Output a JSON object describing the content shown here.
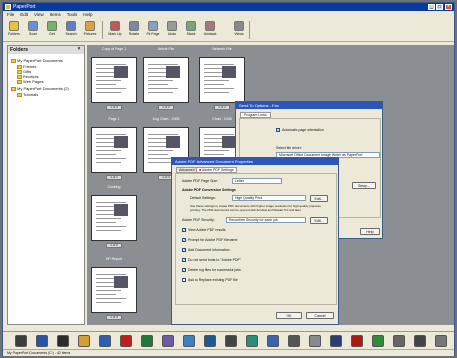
{
  "app": {
    "title": "PaperPort"
  },
  "menu": [
    "File",
    "Edit",
    "View",
    "Items",
    "Tools",
    "Help"
  ],
  "toolbar": [
    {
      "label": "Folders",
      "icon": "folder-icon"
    },
    {
      "label": "Scan",
      "icon": "scan-icon"
    },
    {
      "label": "Get",
      "icon": "get-photo-icon"
    },
    {
      "label": "Search",
      "icon": "search-icon"
    },
    {
      "label": "Pictures",
      "icon": "pictures-icon"
    },
    {
      "label": "Mark Up",
      "icon": "markup-icon"
    },
    {
      "label": "Rotate",
      "icon": "rotate-icon"
    },
    {
      "label": "Fit Page",
      "icon": "fit-page-icon"
    },
    {
      "label": "Undo",
      "icon": "undo-icon"
    },
    {
      "label": "Stack",
      "icon": "stack-icon"
    },
    {
      "label": "Unstack",
      "icon": "unstack-icon"
    },
    {
      "label": "Views",
      "icon": "views-icon"
    }
  ],
  "folders": {
    "title": "Folders",
    "items": [
      {
        "label": "My PaperPort Documents",
        "level": 0
      },
      {
        "label": "Friends",
        "level": 1
      },
      {
        "label": "Gifts",
        "level": 1
      },
      {
        "label": "Receipts",
        "level": 1
      },
      {
        "label": "Web Pages",
        "level": 1
      },
      {
        "label": "My PaperPort Documents (2)",
        "level": 0
      },
      {
        "label": "Tutorials",
        "level": 1
      }
    ]
  },
  "thumbs": [
    {
      "label": "Copy of Page 1",
      "badge": "1 of 3"
    },
    {
      "label": "Article File",
      "badge": "1 of 2"
    },
    {
      "label": "Network File",
      "badge": "1 of 1"
    },
    {
      "label": "Page 1",
      "badge": "1 of 1"
    },
    {
      "label": "Dog Chart - 2005",
      "badge": "1 of 1"
    },
    {
      "label": "Chart - 2006",
      "badge": "1 of 1"
    },
    {
      "label": "Cooking",
      "badge": "1 of 2"
    },
    {
      "label": "HP Report",
      "badge": "1 of 3"
    }
  ],
  "dialog_back": {
    "title": "Send To Options - Fax",
    "tab": "Program Links",
    "check": "Automatic page orientation",
    "select_label": "Select file driver:",
    "select_value": "Microsoft Office Document Image Writer as PaperPort",
    "button": "Setup...",
    "help": "Help"
  },
  "dialog_front": {
    "title": "Adobe PDF Advanced Document Properties",
    "tabs": [
      "Advanced",
      "Adobe PDF Settings"
    ],
    "page_size_label": "Adobe PDF Page Size:",
    "page_size_value": "Letter",
    "conversion_label": "Adobe PDF Conversion Settings",
    "default_label": "Default Settings:",
    "default_value": "High Quality Print",
    "edit_label": "Edit...",
    "desc": "Use these settings to create PDF documents with higher image resolution for high-quality prepress printing. The PDF documents can be opened with Acrobat and Reader 5.0 and later.",
    "security_label": "Adobe PDF Security:",
    "security_value": "Reconfirm Security for each job",
    "checks": [
      {
        "label": "View Adobe PDF results",
        "checked": true
      },
      {
        "label": "Prompt for Adobe PDF filename",
        "checked": true
      },
      {
        "label": "Add Document Information",
        "checked": true
      },
      {
        "label": "Do not send fonts to \"Adobe PDF\"",
        "checked": true
      },
      {
        "label": "Delete log files for successful jobs",
        "checked": true
      },
      {
        "label": "Ask to Replace existing PDF file",
        "checked": false
      }
    ],
    "ok": "OK",
    "cancel": "Cancel"
  },
  "apps": [
    {
      "name": "printer-icon",
      "color": "#3d3d3d"
    },
    {
      "name": "pen-icon",
      "color": "#2455a8"
    },
    {
      "name": "camera-icon",
      "color": "#2b2b2b"
    },
    {
      "name": "photo-icon",
      "color": "#d5a12c"
    },
    {
      "name": "word-icon",
      "color": "#2a5fb5"
    },
    {
      "name": "acrobat-icon",
      "color": "#c21d1d"
    },
    {
      "name": "excel-icon",
      "color": "#1f7a35"
    },
    {
      "name": "image-icon",
      "color": "#6c5aa6"
    },
    {
      "name": "edit-icon",
      "color": "#3c7fc4"
    },
    {
      "name": "ocr-icon",
      "color": "#1c5a8f"
    },
    {
      "name": "text-icon",
      "color": "#444"
    },
    {
      "name": "globe-icon",
      "color": "#2a8f7a"
    },
    {
      "name": "mail-icon",
      "color": "#3a64b0"
    },
    {
      "name": "fax-icon",
      "color": "#555"
    },
    {
      "name": "cd-icon",
      "color": "#8a8a8a"
    },
    {
      "name": "photoshop-icon",
      "color": "#2a3f7a"
    },
    {
      "name": "pdf-icon",
      "color": "#b01818"
    },
    {
      "name": "recycle-icon",
      "color": "#2c8c3a"
    },
    {
      "name": "scanner-icon",
      "color": "#666"
    },
    {
      "name": "printer2-icon",
      "color": "#444"
    },
    {
      "name": "gear-icon",
      "color": "#777"
    }
  ],
  "status": "My PaperPort Documents (C:) - 42 items"
}
